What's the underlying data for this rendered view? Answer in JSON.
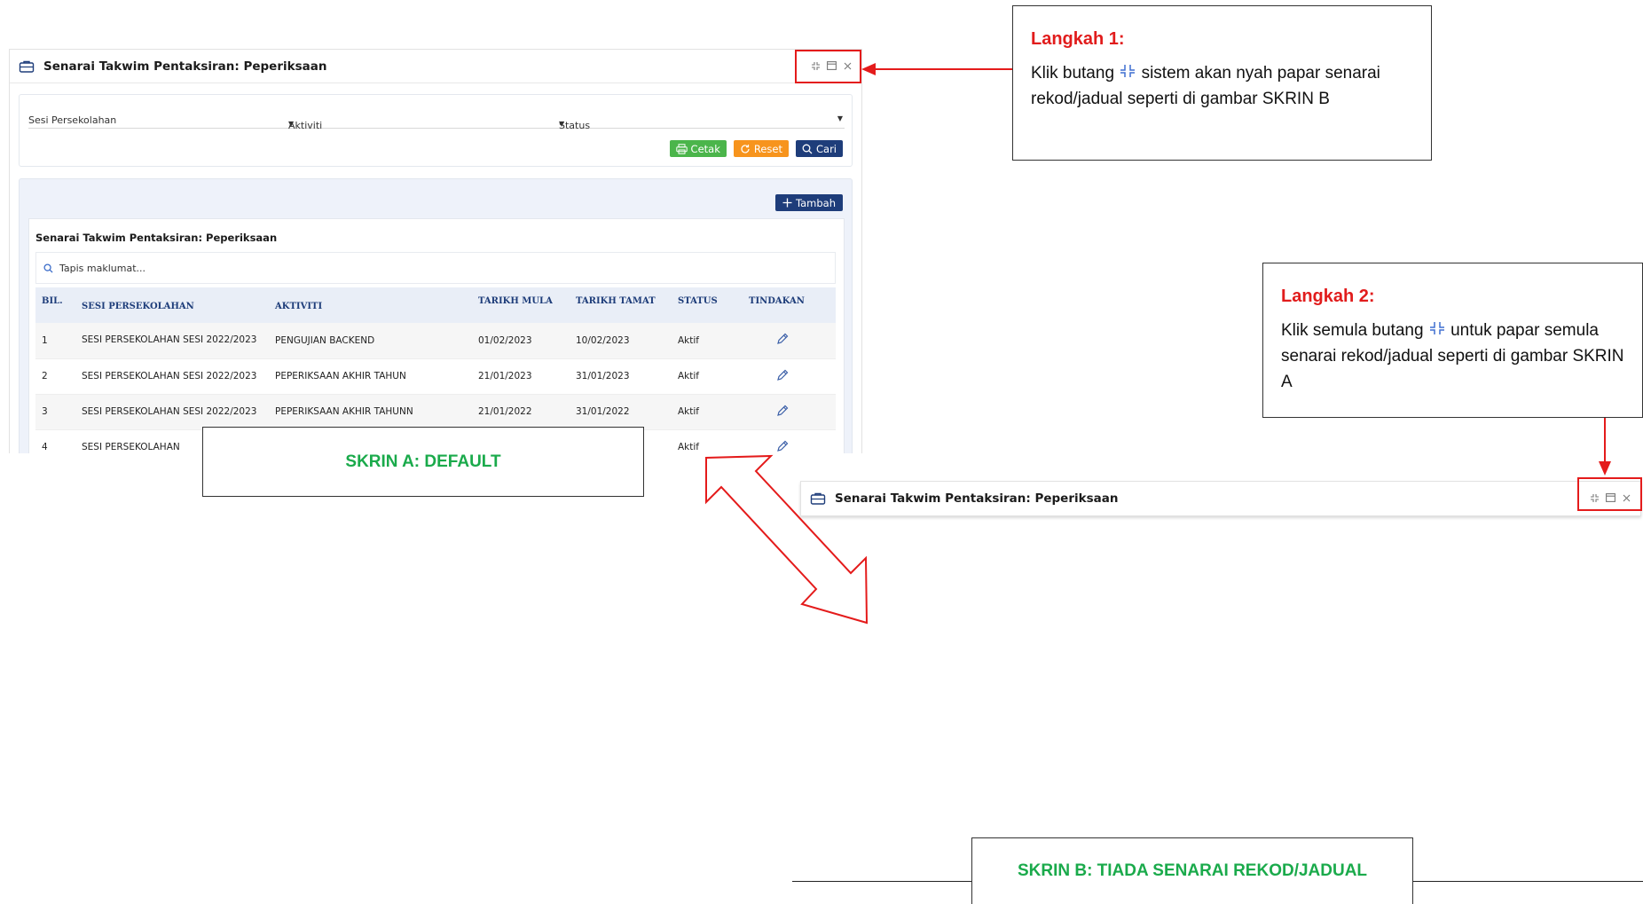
{
  "panel_title": "Senarai Takwim Pentaksiran: Peperiksaan",
  "filters": {
    "sesi_label": "Sesi Persekolahan",
    "aktiviti_label": "Aktiviti",
    "status_label": "Status"
  },
  "buttons": {
    "cetak": "Cetak",
    "reset": "Reset",
    "cari": "Cari",
    "tambah": "Tambah"
  },
  "table": {
    "title": "Senarai Takwim Pentaksiran: Peperiksaan",
    "search_placeholder": "Tapis maklumat...",
    "headers": [
      "BIL.",
      "SESI PERSEKOLAHAN",
      "AKTIVITI",
      "TARIKH MULA",
      "TARIKH TAMAT",
      "STATUS",
      "TINDAKAN"
    ],
    "rows": [
      {
        "bil": "1",
        "sesi": "SESI PERSEKOLAHAN SESI 2022/2023",
        "aktiviti": "PENGUJIAN BACKEND",
        "mula": "01/02/2023",
        "tamat": "10/02/2023",
        "status": "Aktif"
      },
      {
        "bil": "2",
        "sesi": "SESI PERSEKOLAHAN SESI 2022/2023",
        "aktiviti": "PEPERIKSAAN AKHIR TAHUN",
        "mula": "21/01/2023",
        "tamat": "31/01/2023",
        "status": "Aktif"
      },
      {
        "bil": "3",
        "sesi": "SESI PERSEKOLAHAN SESI 2022/2023",
        "aktiviti": "PEPERIKSAAN AKHIR TAHUNN",
        "mula": "21/01/2022",
        "tamat": "31/01/2022",
        "status": "Aktif"
      },
      {
        "bil": "4",
        "sesi": "SESI PERSEKOLAHAN",
        "aktiviti": "",
        "mula": "",
        "tamat": "",
        "status": "Aktif"
      }
    ]
  },
  "notes": {
    "step1_title": "Langkah 1:",
    "step1_pre": "Klik butang",
    "step1_post": "sistem akan nyah papar senarai rekod/jadual seperti di gambar SKRIN B",
    "step2_title": "Langkah 2:",
    "step2_pre": "Klik semula butang",
    "step2_post": "untuk papar semula senarai rekod/jadual seperti di gambar SKRIN A"
  },
  "labels": {
    "screen_a": "SKRIN A: DEFAULT",
    "screen_b": "SKRIN B: TIADA SENARAI REKOD/JADUAL"
  },
  "colors": {
    "accent_red": "#e41b1b",
    "label_green": "#1aaa4b",
    "navy": "#1e3d7a",
    "green_btn": "#4bb54b",
    "orange_btn": "#f7941d"
  }
}
